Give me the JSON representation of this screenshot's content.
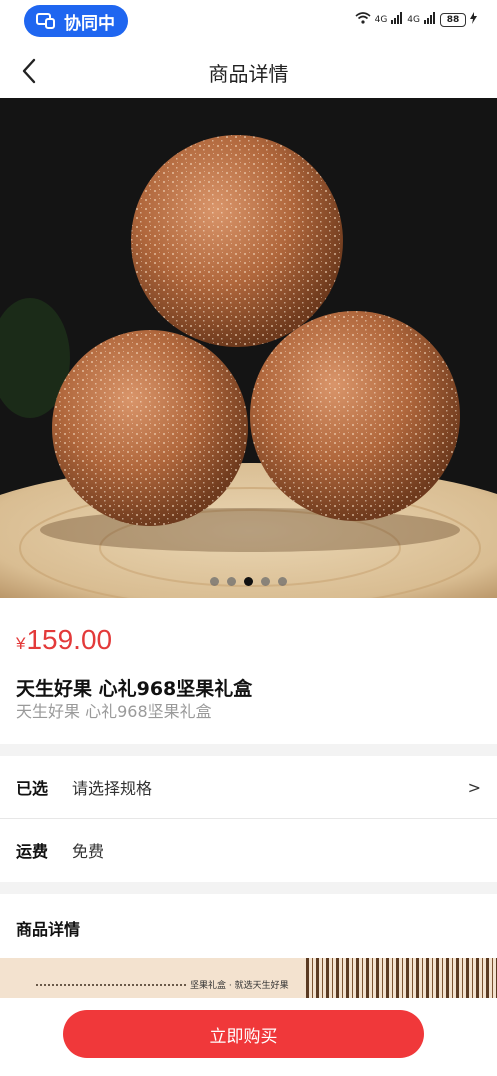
{
  "status_bar": {
    "collab_label": "协同中",
    "signal_1": "4G",
    "signal_2": "4G",
    "battery": "88"
  },
  "nav": {
    "title": "商品详情"
  },
  "carousel": {
    "page_count": 5,
    "active_index": 2
  },
  "product": {
    "currency": "¥",
    "price": "159.00",
    "name": "天生好果 心礼968坚果礼盒",
    "subtitle": "天生好果 心礼968坚果礼盒"
  },
  "spec_row": {
    "label": "已选",
    "value": "请选择规格",
    "arrow": ">"
  },
  "shipping_row": {
    "label": "运费",
    "value": "免费"
  },
  "details": {
    "heading": "商品详情",
    "banner_text": "坚果礼盒 · 就选天生好果"
  },
  "actions": {
    "buy_label": "立即购买"
  },
  "colors": {
    "accent_red": "#f0383a",
    "price_red": "#e33a3a",
    "collab_blue": "#1f66f0"
  }
}
